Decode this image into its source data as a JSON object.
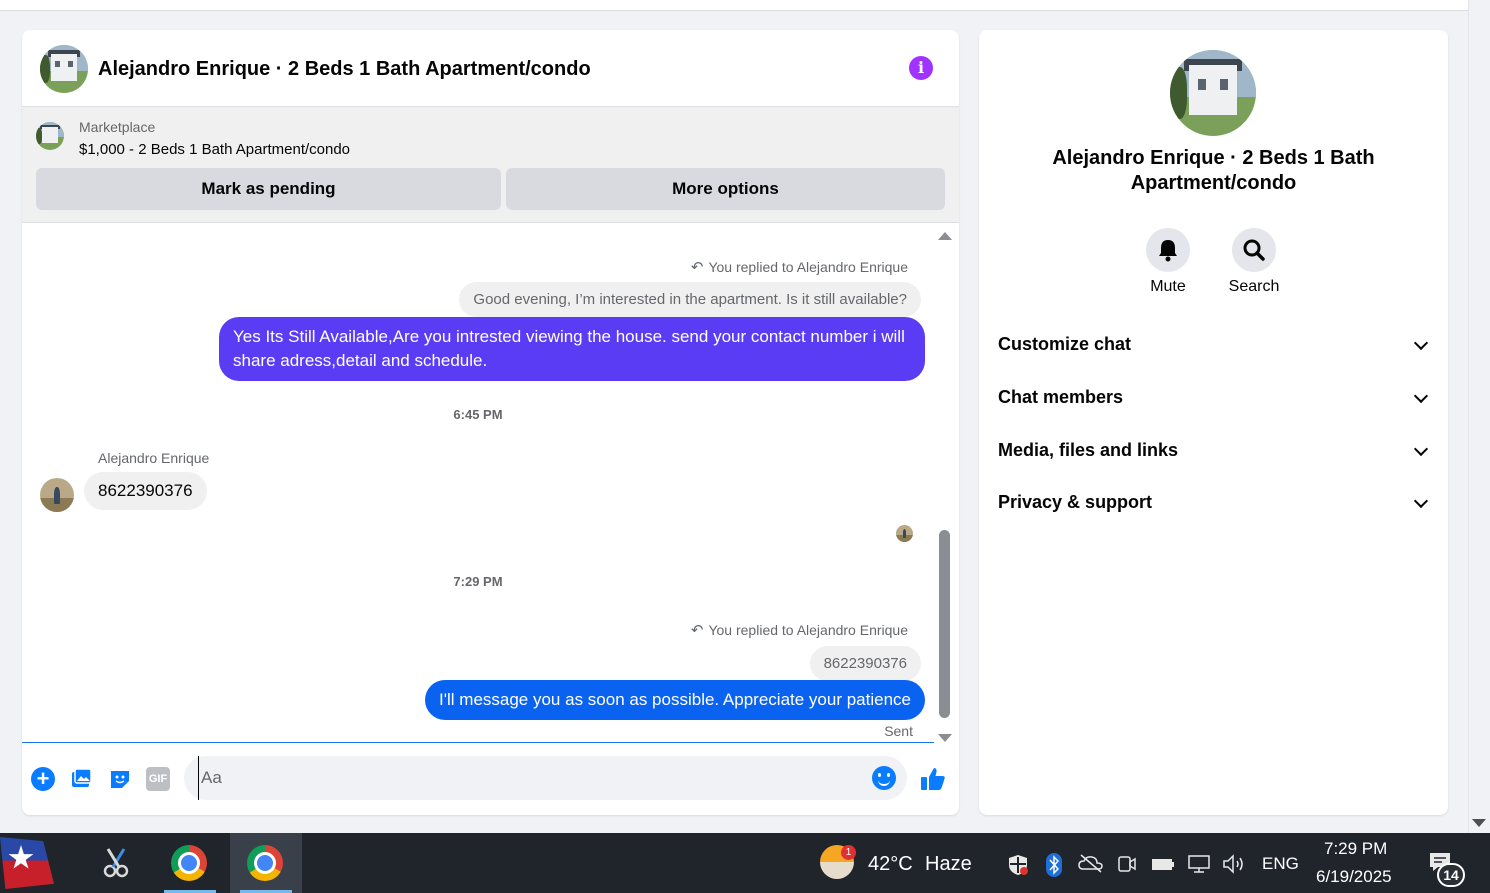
{
  "header": {
    "title": "Alejandro Enrique · 2 Beds 1 Bath Apartment/condo",
    "info_icon": "info-icon"
  },
  "marketplace": {
    "label": "Marketplace",
    "listing": "$1,000 - 2 Beds 1 Bath Apartment/condo",
    "pending_label": "Mark as pending",
    "options_label": "More options"
  },
  "messages": {
    "reply_note_1": "You replied to Alejandro Enrique",
    "quoted_1": "Good evening, I’m interested in the apartment. Is it still available?",
    "out_1": "Yes Its Still Available,Are you intrested viewing the house. send your contact number i will share adress,detail and schedule.",
    "time_1": "6:45 PM",
    "sender_name": "Alejandro Enrique",
    "in_1": "8622390376",
    "time_2": "7:29 PM",
    "reply_note_2": "You replied to Alejandro Enrique",
    "quoted_2": "8622390376",
    "out_2": "I'll message you as soon as possible. Appreciate your patience",
    "status": "Sent"
  },
  "composer": {
    "placeholder": "Aa",
    "gif_label": "GIF"
  },
  "details": {
    "title": "Alejandro Enrique · 2 Beds 1 Bath Apartment/condo",
    "mute_label": "Mute",
    "search_label": "Search",
    "sections": [
      "Customize chat",
      "Chat members",
      "Media, files and links",
      "Privacy & support"
    ]
  },
  "taskbar": {
    "temperature": "42°C",
    "weather": "Haze",
    "weather_badge": "1",
    "language": "ENG",
    "time": "7:29 PM",
    "date": "6/19/2025",
    "notifications": "14"
  },
  "colors": {
    "outgoing_purple": "#5b3cf5",
    "outgoing_blue": "#0a63f0",
    "accent": "#0a7cff",
    "info_purple": "#a033ff"
  }
}
